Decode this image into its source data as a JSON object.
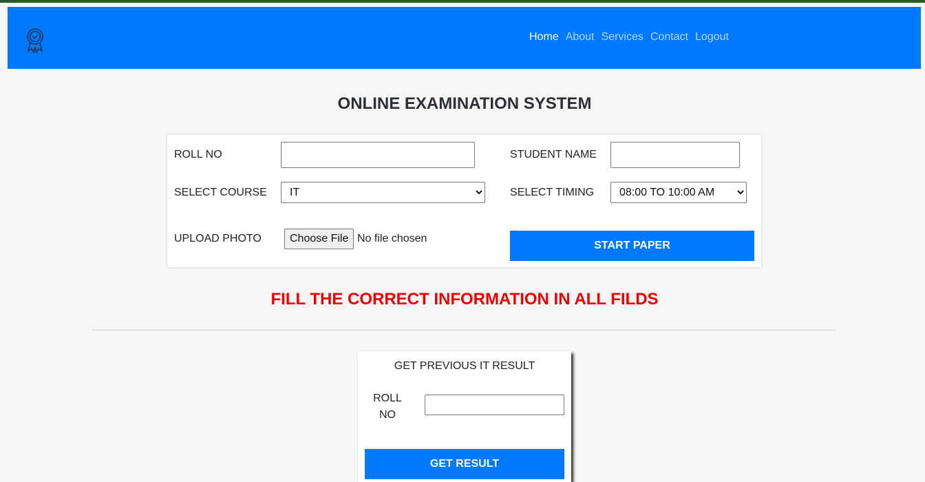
{
  "nav": {
    "links": [
      "Home",
      "About",
      "Services",
      "Contact",
      "Logout"
    ],
    "active": "Home",
    "logo_icon": "award-badge-icon"
  },
  "page": {
    "title": "ONLINE EXAMINATION SYSTEM",
    "warning": "FILL THE CORRECT INFORMATION IN ALL FILDS"
  },
  "form": {
    "roll_label": "ROLL NO",
    "roll_value": "",
    "name_label": "STUDENT NAME",
    "name_value": "",
    "course_label": "SELECT COURSE",
    "course_value": "IT",
    "timing_label": "SELECT TIMING",
    "timing_value": "08:00 TO 10:00 AM",
    "photo_label": "UPLOAD PHOTO",
    "file_button": "Choose File",
    "file_status": "No file chosen",
    "start_button": "START PAPER"
  },
  "result": {
    "title": "GET PREVIOUS IT RESULT",
    "roll_label": "ROLL NO",
    "roll_value": "",
    "button": "GET RESULT"
  },
  "colors": {
    "primary": "#0078ff",
    "warning": "#ee0000",
    "topline": "#1e5f2a"
  }
}
